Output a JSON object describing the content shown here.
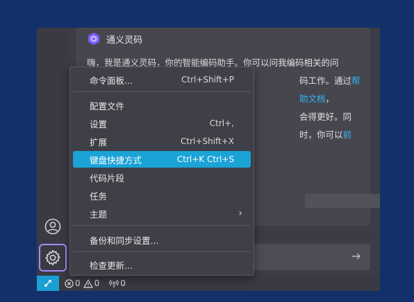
{
  "chat": {
    "title": "通义灵码",
    "line1": "嗨，我是通义灵码，你的智能编码助手。你可以问我编码相关的问",
    "line2_visible": "码工作。通过",
    "line2_link": "帮助文档",
    "line2_end": "，",
    "line3_visible": "会得更好。同时，你可以",
    "line3_link": "前"
  },
  "menu": {
    "items": [
      {
        "label": "命令面板...",
        "shortcut": "Ctrl+Shift+P"
      },
      {
        "label": "配置文件",
        "shortcut": ""
      },
      {
        "label": "设置",
        "shortcut": "Ctrl+,"
      },
      {
        "label": "扩展",
        "shortcut": "Ctrl+Shift+X"
      },
      {
        "label": "键盘快捷方式",
        "shortcut": "Ctrl+K Ctrl+S"
      },
      {
        "label": "代码片段",
        "shortcut": ""
      },
      {
        "label": "任务",
        "shortcut": ""
      },
      {
        "label": "主题",
        "shortcut": "›"
      },
      {
        "label": "备份和同步设置...",
        "shortcut": ""
      },
      {
        "label": "检查更新...",
        "shortcut": ""
      }
    ]
  },
  "status": {
    "errors": "0",
    "warnings": "0",
    "ports": "0"
  },
  "colors": {
    "accent": "#1aa3d6",
    "link": "#35b3f0",
    "gear_highlight": "#a78bfa",
    "background": "#14306a"
  },
  "icons": {
    "logo": "tongyi-logo-icon",
    "account": "account-icon",
    "settings": "gear-icon",
    "send": "arrow-right-icon",
    "remote": "remote-icon",
    "error": "error-icon",
    "warning": "warning-icon",
    "ports": "broadcast-icon"
  }
}
